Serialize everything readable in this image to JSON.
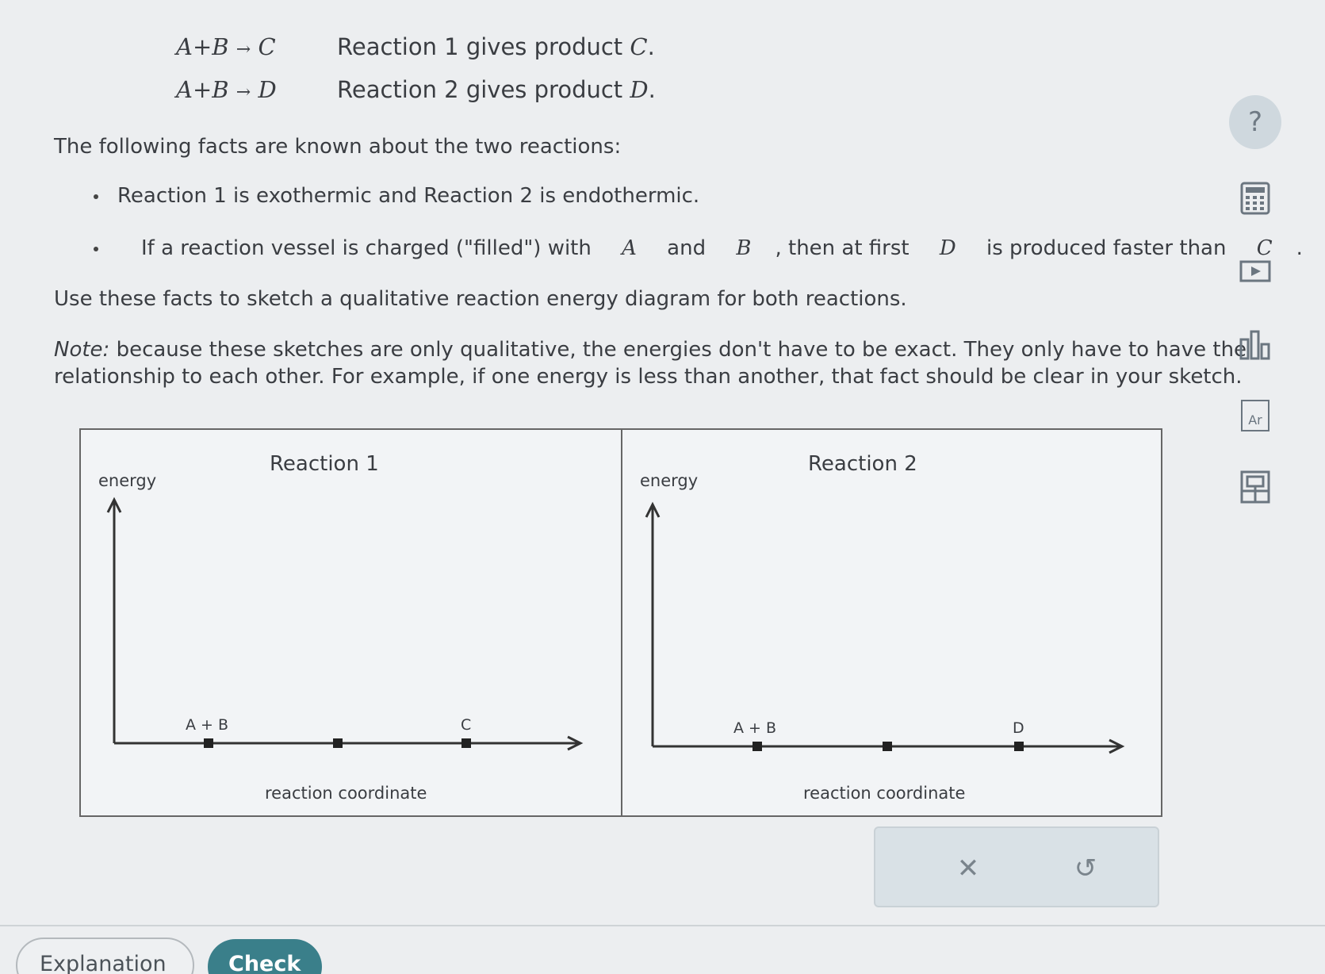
{
  "reactions": [
    {
      "equation_lhs": "A+B",
      "equation_rhs": "C",
      "desc_prefix": "Reaction 1 gives product ",
      "desc_var": "C",
      "desc_suffix": "."
    },
    {
      "equation_lhs": "A+B",
      "equation_rhs": "D",
      "desc_prefix": "Reaction 2 gives product ",
      "desc_var": "D",
      "desc_suffix": "."
    }
  ],
  "facts_intro": "The following facts are known about the two reactions:",
  "facts": [
    {
      "text": "Reaction 1 is exothermic and Reaction 2 is endothermic."
    },
    {
      "parts": [
        "If a reaction vessel is charged (\"filled\") with ",
        "A",
        " and ",
        "B",
        ", then at first ",
        "D",
        " is produced faster than ",
        "C",
        "."
      ]
    }
  ],
  "instruction": "Use these facts to sketch a qualitative reaction energy diagram for both reactions.",
  "note_label": "Note:",
  "note_text": " because these sketches are only qualitative, the energies don't have to be exact. They only have to have the relationship to each other. For example, if one energy is less than another, that fact should be clear in your sketch.",
  "diagrams": [
    {
      "title": "Reaction 1",
      "y_axis_label": "energy",
      "x_axis_label": "reaction coordinate",
      "point_labels": [
        "A + B",
        "",
        "C"
      ]
    },
    {
      "title": "Reaction 2",
      "y_axis_label": "energy",
      "x_axis_label": "reaction coordinate",
      "point_labels": [
        "A + B",
        "",
        "D"
      ]
    }
  ],
  "side_tools": [
    "help-icon",
    "calculator-icon",
    "video-icon",
    "data-table-icon",
    "periodic-table-icon",
    "reference-icon"
  ],
  "help_symbol": "?",
  "periodic_symbol": "Ar",
  "actions": {
    "clear_symbol": "✕",
    "undo_symbol": "↺"
  },
  "buttons": {
    "explanation": "Explanation",
    "check": "Check"
  },
  "colors": {
    "check_button": "#3a7f8a",
    "background": "#eceef0",
    "panel_border": "#666666"
  }
}
